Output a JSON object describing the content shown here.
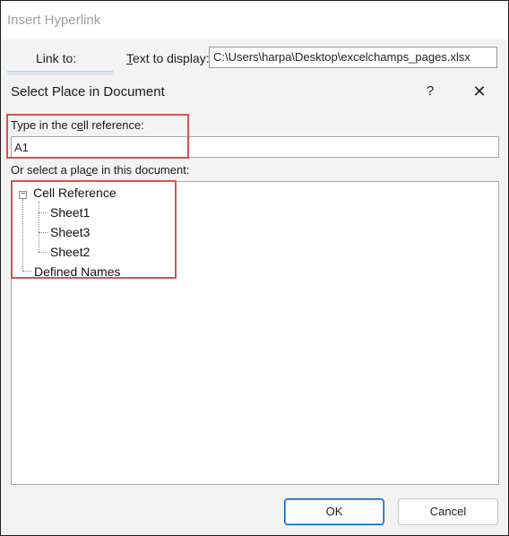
{
  "parent_window": {
    "title": "Insert Hyperlink",
    "link_to_label": "Link to:",
    "text_to_display_label": "ext to display:",
    "text_to_display_prefix": "T",
    "text_to_display_value": "C:\\Users\\harpa\\Desktop\\excelchamps_pages.xlsx"
  },
  "dialog": {
    "title": "Select Place in Document",
    "help_icon": "?",
    "close_icon": "✕",
    "cell_reference": {
      "label_prefix": "Type in the c",
      "label_underlined": "e",
      "label_suffix": "ll reference:",
      "value": "A1"
    },
    "place": {
      "label_prefix": "Or select a pla",
      "label_underlined": "c",
      "label_suffix": "e in this document:"
    },
    "tree": {
      "root": "Cell Reference",
      "expander": "−",
      "sheets": [
        "Sheet1",
        "Sheet3",
        "Sheet2"
      ],
      "defined_names": "Defined Names"
    },
    "buttons": {
      "ok": "OK",
      "cancel": "Cancel"
    }
  },
  "colors": {
    "highlight": "#d9534f",
    "dialog_bg": "#f3f3f3",
    "ok_border": "#0a64c8"
  }
}
